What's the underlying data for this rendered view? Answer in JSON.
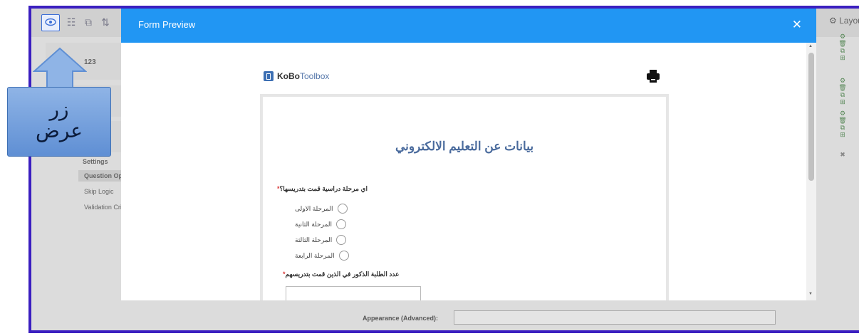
{
  "app": {
    "toolbar": {
      "layout_label": "Layout &"
    },
    "rows": [
      "123"
    ],
    "settings_label": "Settings",
    "side_links": [
      "Question Opti",
      "Skip Logic",
      "Validation Crit"
    ],
    "appearance_label": "Appearance (Advanced):"
  },
  "modal": {
    "title": "Form Preview",
    "close_symbol": "✕"
  },
  "preview": {
    "logo_kobo": "KoBo",
    "logo_toolbox": "Toolbox",
    "form_title": "بيانات عن التعليم الالكتروني",
    "q1": {
      "label": "اي مرحلة دراسية قمت بتدريسها؟",
      "required_mark": "*",
      "options": [
        "المرحلة الاولى",
        "المرحلة الثانية",
        "المرحلة الثالثة",
        "المرحلة الرابعة"
      ]
    },
    "q2": {
      "label": "عدد الطلبة الذكور في الذين قمت بتدريسهم",
      "required_mark": "*"
    }
  },
  "annotation": {
    "line1": "زر",
    "line2": "عرض"
  },
  "colors": {
    "modal_header": "#2196f3",
    "accent": "#f06b28",
    "frame": "#3b1fc0",
    "title_text": "#4a6b9d"
  }
}
